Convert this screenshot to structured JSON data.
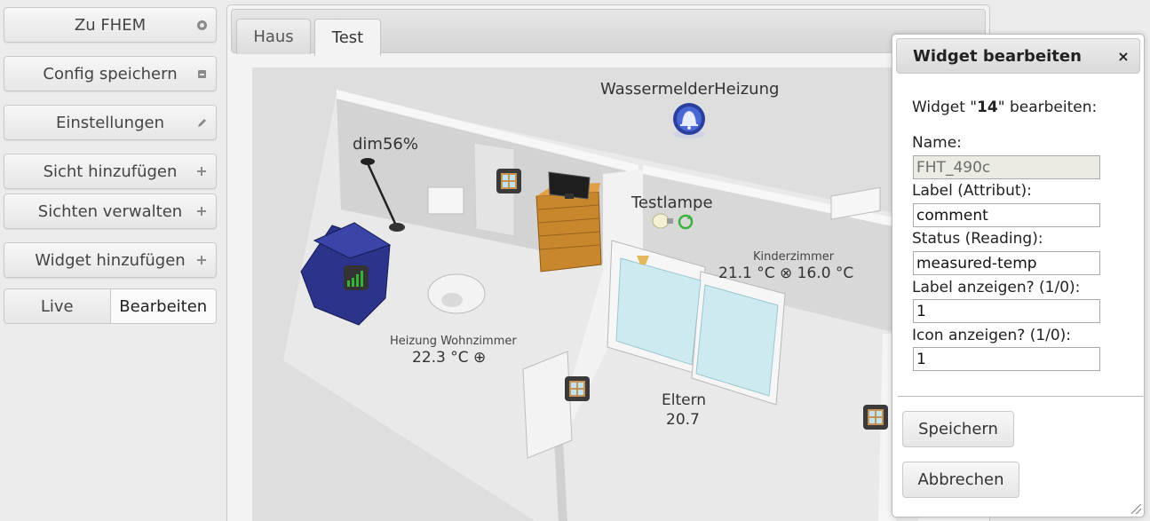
{
  "sidebar": {
    "buttons": [
      {
        "label": "Zu FHEM",
        "icon": "circle-icon"
      },
      {
        "label": "Config speichern",
        "icon": "save-icon"
      },
      {
        "label": "Einstellungen",
        "icon": "edit-icon"
      },
      {
        "label": "Sicht hinzufügen",
        "icon": "plus-icon"
      },
      {
        "label": "Sichten verwalten",
        "icon": "plus-icon"
      },
      {
        "label": "Widget hinzufügen",
        "icon": "plus-icon"
      }
    ],
    "mode": {
      "live": "Live",
      "edit": "Bearbeiten",
      "selected": "Bearbeiten"
    }
  },
  "tabs": [
    {
      "label": "Haus",
      "active": false
    },
    {
      "label": "Test",
      "active": true
    }
  ],
  "floorplan": {
    "wassermelder": "WassermelderHeizung",
    "dim": "dim56%",
    "testlampe": "Testlampe",
    "kinderzimmer_label": "Kinderzimmer",
    "kinderzimmer_value": "21.1 °C ⊗ 16.0 °C",
    "heizung_label": "Heizung Wohnzimmer",
    "heizung_value": "22.3 °C ⊕",
    "eltern_label": "Eltern",
    "eltern_value": "20.7"
  },
  "dialog": {
    "title": "Widget bearbeiten",
    "close": "×",
    "intro_prefix": "Widget \"",
    "widget_id": "14",
    "intro_suffix": "\" bearbeiten:",
    "fields": [
      {
        "label": "Name:",
        "value": "FHT_490c",
        "disabled": true
      },
      {
        "label": "Label (Attribut):",
        "value": "comment",
        "disabled": false
      },
      {
        "label": "Status (Reading):",
        "value": "measured-temp",
        "disabled": false
      },
      {
        "label": "Label anzeigen? (1/0):",
        "value": "1",
        "disabled": false
      },
      {
        "label": "Icon anzeigen? (1/0):",
        "value": "1",
        "disabled": false
      }
    ],
    "save": "Speichern",
    "cancel": "Abbrechen"
  },
  "colors": {
    "accent_blue": "#2a3f9e",
    "signal_green": "#36b336",
    "dialog_bg": "#ffffff",
    "disabled_field": "#ebebe4"
  }
}
